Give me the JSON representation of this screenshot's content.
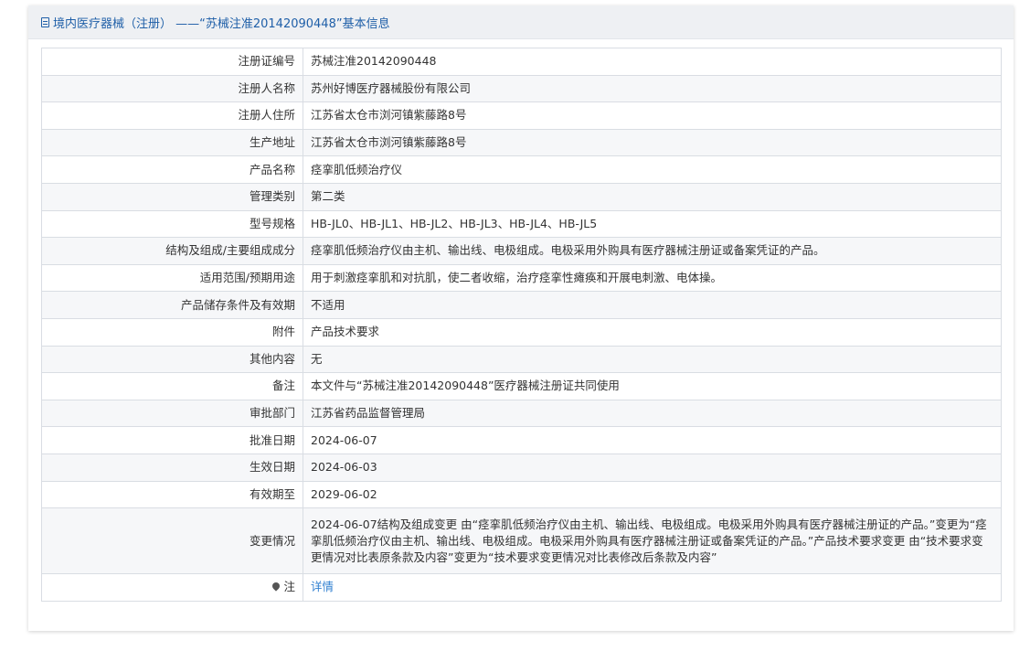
{
  "header": {
    "title": "境内医疗器械（注册） ——“苏械注准20142090448”基本信息"
  },
  "rows": [
    {
      "label": "注册证编号",
      "value": "苏械注准20142090448"
    },
    {
      "label": "注册人名称",
      "value": "苏州好博医疗器械股份有限公司"
    },
    {
      "label": "注册人住所",
      "value": "江苏省太仓市浏河镇紫藤路8号"
    },
    {
      "label": "生产地址",
      "value": "江苏省太仓市浏河镇紫藤路8号"
    },
    {
      "label": "产品名称",
      "value": "痉挛肌低频治疗仪"
    },
    {
      "label": "管理类别",
      "value": "第二类"
    },
    {
      "label": "型号规格",
      "value": "HB-JL0、HB-JL1、HB-JL2、HB-JL3、HB-JL4、HB-JL5"
    },
    {
      "label": "结构及组成/主要组成成分",
      "value": "痉挛肌低频治疗仪由主机、输出线、电极组成。电极采用外购具有医疗器械注册证或备案凭证的产品。"
    },
    {
      "label": "适用范围/预期用途",
      "value": "用于刺激痉挛肌和对抗肌，使二者收缩，治疗痉挛性瘫痪和开展电刺激、电体操。"
    },
    {
      "label": "产品储存条件及有效期",
      "value": "不适用"
    },
    {
      "label": "附件",
      "value": "产品技术要求"
    },
    {
      "label": "其他内容",
      "value": "无"
    },
    {
      "label": "备注",
      "value": "本文件与“苏械注准20142090448”医疗器械注册证共同使用"
    },
    {
      "label": "审批部门",
      "value": "江苏省药品监督管理局"
    },
    {
      "label": "批准日期",
      "value": "2024-06-07"
    },
    {
      "label": "生效日期",
      "value": "2024-06-03"
    },
    {
      "label": "有效期至",
      "value": "2029-06-02"
    },
    {
      "label": "变更情况",
      "value": "2024-06-07结构及组成变更 由“痉挛肌低频治疗仪由主机、输出线、电极组成。电极采用外购具有医疗器械注册证的产品。”变更为“痉挛肌低频治疗仪由主机、输出线、电极组成。电极采用外购具有医疗器械注册证或备案凭证的产品。”产品技术要求变更 由“技术要求变更情况对比表原条款及内容”变更为“技术要求变更情况对比表修改后条款及内容”"
    }
  ],
  "note": {
    "label": "注",
    "link_text": "详情",
    "icon": "pin-icon"
  }
}
